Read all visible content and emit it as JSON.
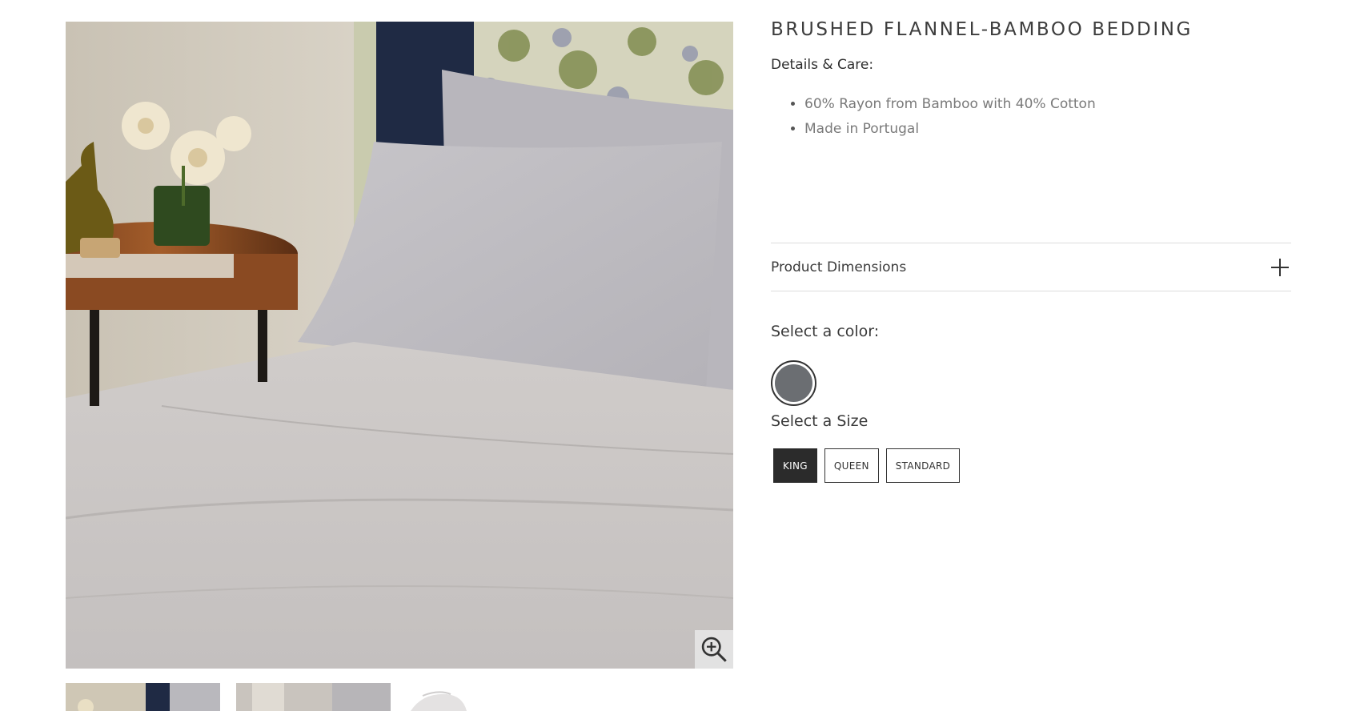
{
  "product": {
    "title": "BRUSHED FLANNEL-BAMBOO BEDDING",
    "details_label": "Details & Care:",
    "care_items": [
      "60% Rayon from Bamboo with 40% Cotton",
      "Made in Portugal"
    ]
  },
  "accordion": {
    "label": "Product Dimensions",
    "icon": "plus-icon"
  },
  "color_selector": {
    "label": "Select a color:",
    "selected_swatch_color": "#6b6e72"
  },
  "size_selector": {
    "label": "Select a Size",
    "options": [
      "KING",
      "QUEEN",
      "STANDARD"
    ],
    "selected": "KING"
  },
  "gallery": {
    "zoom_icon": "zoom-in-icon",
    "thumbnail_count": 3
  }
}
